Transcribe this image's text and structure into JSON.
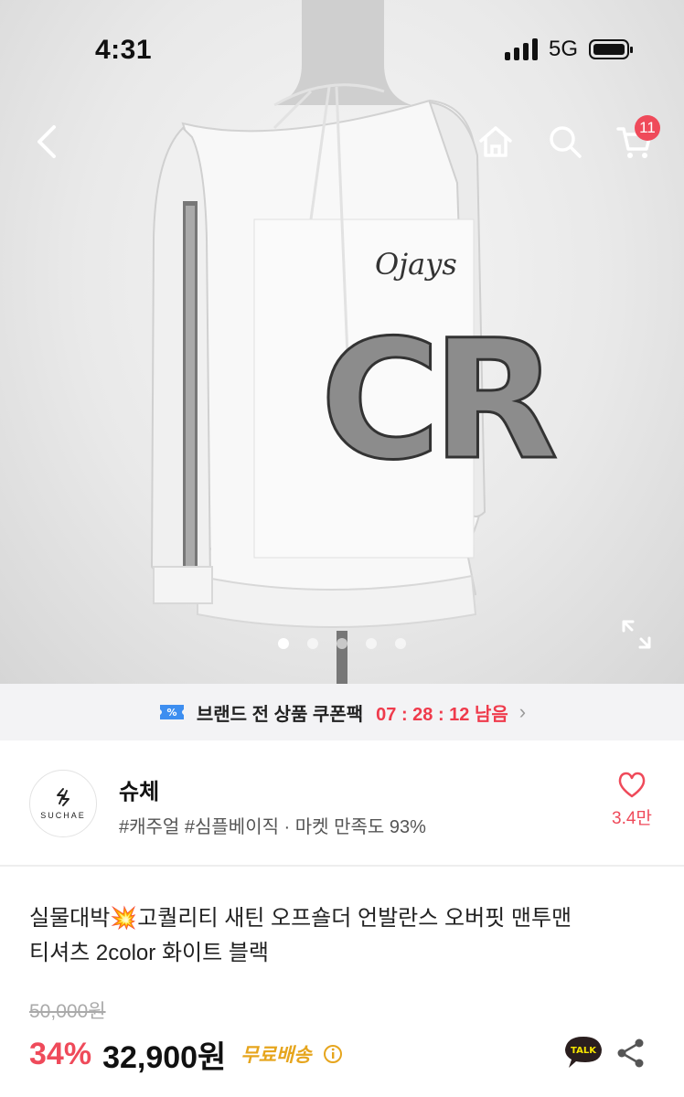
{
  "status_bar": {
    "time": "4:31",
    "network": "5G"
  },
  "nav": {
    "cart_count": "11"
  },
  "gallery": {
    "page_count": 5,
    "active_index": 0,
    "image_text_script": "Ojays",
    "image_text_letters": "CR"
  },
  "coupon": {
    "label": "브랜드 전 상품 쿠폰팩",
    "timer": "07 : 28 : 12 남음",
    "chevron": "›"
  },
  "store": {
    "logo_text": "SUCHAE",
    "name": "슈체",
    "meta": "#캐주얼 #심플베이직 · 마켓 만족도 93%",
    "like_count": "3.4만"
  },
  "product": {
    "title_line1": "실물대박💥고퀄리티 새틴 오프숄더 언발란스 오버핏 맨투맨",
    "title_line2": "티셔츠 2color 화이트 블랙",
    "original_price": "50,000원",
    "discount": "34%",
    "price": "32,900원",
    "shipping": "무료배송",
    "talk_label": "TALK"
  },
  "colors": {
    "accent": "#ef4a5a",
    "timer": "#ef3b4c",
    "shipping": "#e6a51d"
  }
}
